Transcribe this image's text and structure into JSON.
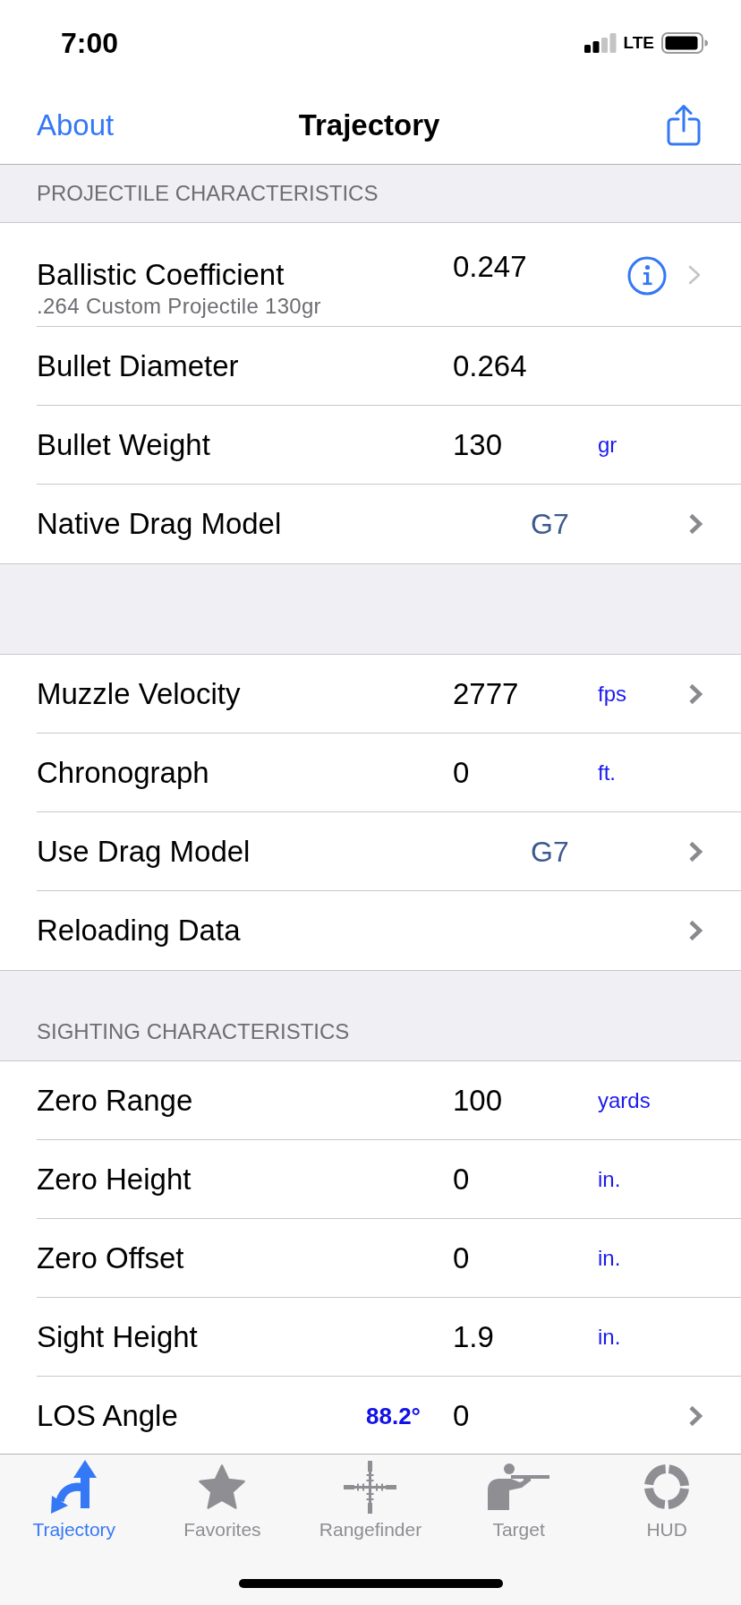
{
  "status_bar": {
    "time": "7:00",
    "network": "LTE"
  },
  "nav_bar": {
    "left_button": "About",
    "title": "Trajectory"
  },
  "sections": [
    {
      "header": "PROJECTILE CHARACTERISTICS",
      "rows": [
        {
          "kind": "info",
          "label": "Ballistic Coefficient",
          "subtitle": ".264 Custom Projectile 130gr",
          "value": "0.247",
          "disclosure": true
        },
        {
          "kind": "entry",
          "label": "Bullet Diameter",
          "value": "0.264",
          "disclosure": false
        },
        {
          "kind": "entry",
          "label": "Bullet Weight",
          "value": "130",
          "unit": "gr",
          "disclosure": false
        },
        {
          "kind": "choice",
          "label": "Native Drag Model",
          "choice": "G7",
          "disclosure": true
        }
      ]
    },
    {
      "rows": [
        {
          "kind": "entry",
          "label": "Muzzle Velocity",
          "value": "2777",
          "unit": "fps",
          "disclosure": true
        },
        {
          "kind": "entry",
          "label": "Chronograph",
          "value": "0",
          "unit": "ft.",
          "disclosure": false
        },
        {
          "kind": "choice",
          "label": "Use Drag Model",
          "choice": "G7",
          "disclosure": true
        },
        {
          "kind": "link",
          "label": "Reloading Data",
          "disclosure": true
        }
      ]
    },
    {
      "header": "SIGHTING CHARACTERISTICS",
      "rows": [
        {
          "kind": "entry",
          "label": "Zero Range",
          "value": "100",
          "unit": "yards",
          "disclosure": false
        },
        {
          "kind": "entry",
          "label": "Zero Height",
          "value": "0",
          "unit": "in.",
          "disclosure": false
        },
        {
          "kind": "entry",
          "label": "Zero Offset",
          "value": "0",
          "unit": "in.",
          "disclosure": false
        },
        {
          "kind": "entry",
          "label": "Sight Height",
          "value": "1.9",
          "unit": "in.",
          "disclosure": false
        },
        {
          "kind": "entry",
          "label": "LOS Angle",
          "reading": "88.2°",
          "value": "0",
          "disclosure": true
        }
      ]
    }
  ],
  "tabs": [
    {
      "label": "Trajectory",
      "selected": true
    },
    {
      "label": "Favorites",
      "selected": false
    },
    {
      "label": "Rangefinder",
      "selected": false
    },
    {
      "label": "Target",
      "selected": false
    },
    {
      "label": "HUD",
      "selected": false
    }
  ]
}
